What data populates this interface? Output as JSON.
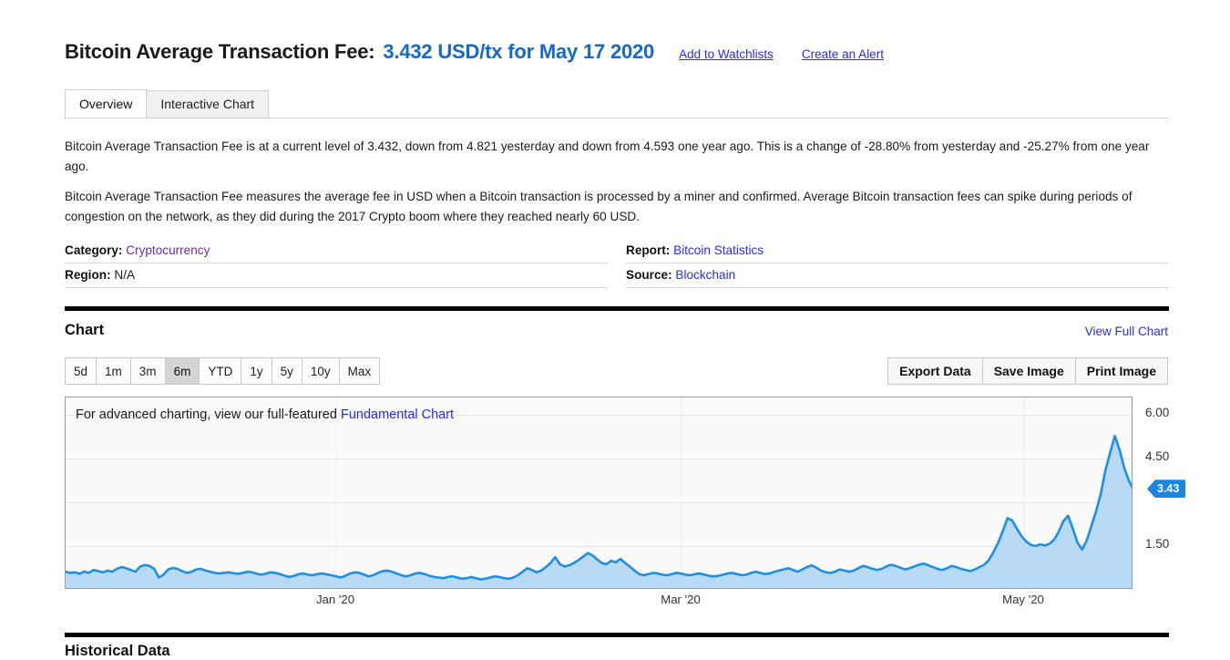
{
  "header": {
    "title": "Bitcoin Average Transaction Fee:",
    "value": "3.432 USD/tx for May 17 2020",
    "watchlist_link": "Add to Watchlists",
    "alert_link": "Create an Alert",
    "accent_color": "#1569c7",
    "link_color": "#2a2aee"
  },
  "tabs": [
    {
      "label": "Overview",
      "active": true
    },
    {
      "label": "Interactive Chart",
      "active": false
    }
  ],
  "description": {
    "paragraph1": "Bitcoin Average Transaction Fee is at a current level of 3.432, down from 4.821 yesterday and down from 4.593 one year ago. This is a change of -28.80% from yesterday and -25.27% from one year ago.",
    "paragraph2": "Bitcoin Average Transaction Fee measures the average fee in USD when a Bitcoin transaction is processed by a miner and confirmed. Average Bitcoin transaction fees can spike during periods of congestion on the network, as they did during the 2017 Crypto boom where they reached nearly 60 USD."
  },
  "meta": {
    "category_label": "Category:",
    "category_value": "Cryptocurrency",
    "region_label": "Region:",
    "region_value": "N/A",
    "report_label": "Report:",
    "report_value": "Bitcoin Statistics",
    "source_label": "Source:",
    "source_value": "Blockchain"
  },
  "chart_section": {
    "title": "Chart",
    "view_full_chart": "View Full Chart",
    "ranges": [
      "5d",
      "1m",
      "3m",
      "6m",
      "YTD",
      "1y",
      "5y",
      "10y",
      "Max"
    ],
    "selected_range": "6m",
    "actions": [
      "Export Data",
      "Save Image",
      "Print Image"
    ],
    "note_prefix": "For advanced charting, view our full-featured ",
    "note_link": "Fundamental Chart"
  },
  "historical": {
    "title": "Historical Data"
  },
  "chart_data": {
    "type": "area",
    "title": "Bitcoin Average Transaction Fee",
    "xlabel": "",
    "ylabel": "USD/tx",
    "ylim": [
      0,
      6.6
    ],
    "xlim": [
      "2019-11-17",
      "2020-05-17"
    ],
    "grid": true,
    "legend": "none",
    "line_color": "#1f8fe5",
    "fill_color": "#b8daf5",
    "ytick_labels": [
      "6.00",
      "4.50",
      "1.50"
    ],
    "yticks": [
      6.0,
      4.5,
      3.0,
      1.5
    ],
    "xtick_labels": [
      "Jan '20",
      "Mar '20",
      "May '20"
    ],
    "xticks": [
      0.2535,
      0.5766,
      0.8976
    ],
    "last_value_badge": "3.43",
    "last_value": 3.432,
    "series": [
      {
        "name": "Bitcoin Average Transaction Fee",
        "values": [
          0.62,
          0.58,
          0.6,
          0.55,
          0.63,
          0.58,
          0.68,
          0.64,
          0.6,
          0.66,
          0.62,
          0.72,
          0.78,
          0.74,
          0.68,
          0.62,
          0.8,
          0.85,
          0.82,
          0.72,
          0.42,
          0.52,
          0.7,
          0.75,
          0.72,
          0.64,
          0.58,
          0.62,
          0.7,
          0.72,
          0.66,
          0.62,
          0.58,
          0.56,
          0.58,
          0.6,
          0.57,
          0.55,
          0.58,
          0.62,
          0.6,
          0.55,
          0.52,
          0.56,
          0.6,
          0.58,
          0.54,
          0.48,
          0.44,
          0.48,
          0.54,
          0.56,
          0.52,
          0.5,
          0.54,
          0.56,
          0.53,
          0.5,
          0.46,
          0.42,
          0.48,
          0.56,
          0.6,
          0.58,
          0.52,
          0.46,
          0.5,
          0.58,
          0.64,
          0.66,
          0.62,
          0.56,
          0.5,
          0.46,
          0.5,
          0.56,
          0.58,
          0.54,
          0.48,
          0.44,
          0.42,
          0.4,
          0.44,
          0.46,
          0.42,
          0.38,
          0.4,
          0.44,
          0.4,
          0.36,
          0.38,
          0.42,
          0.46,
          0.44,
          0.4,
          0.38,
          0.42,
          0.5,
          0.62,
          0.74,
          0.68,
          0.6,
          0.66,
          0.78,
          0.92,
          1.12,
          0.88,
          0.8,
          0.84,
          0.92,
          1.02,
          1.14,
          1.26,
          1.18,
          1.04,
          0.92,
          0.88,
          1.0,
          0.94,
          1.06,
          0.92,
          0.8,
          0.66,
          0.54,
          0.5,
          0.54,
          0.58,
          0.56,
          0.52,
          0.5,
          0.54,
          0.58,
          0.56,
          0.52,
          0.5,
          0.54,
          0.56,
          0.52,
          0.48,
          0.46,
          0.48,
          0.52,
          0.56,
          0.58,
          0.54,
          0.5,
          0.52,
          0.58,
          0.62,
          0.58,
          0.54,
          0.56,
          0.62,
          0.66,
          0.7,
          0.74,
          0.68,
          0.62,
          0.7,
          0.78,
          0.84,
          0.76,
          0.66,
          0.6,
          0.58,
          0.62,
          0.7,
          0.66,
          0.62,
          0.66,
          0.74,
          0.82,
          0.78,
          0.72,
          0.68,
          0.72,
          0.8,
          0.86,
          0.82,
          0.76,
          0.7,
          0.74,
          0.8,
          0.86,
          0.9,
          0.84,
          0.78,
          0.72,
          0.68,
          0.74,
          0.82,
          0.78,
          0.72,
          0.68,
          0.64,
          0.7,
          0.78,
          0.86,
          1.02,
          1.3,
          1.62,
          2.02,
          2.46,
          2.38,
          2.1,
          1.84,
          1.66,
          1.54,
          1.5,
          1.56,
          1.52,
          1.58,
          1.72,
          2.0,
          2.36,
          2.54,
          2.1,
          1.62,
          1.38,
          1.7,
          2.2,
          2.7,
          3.3,
          4.1,
          4.7,
          5.28,
          4.82,
          4.2,
          3.76,
          3.43
        ]
      }
    ]
  }
}
